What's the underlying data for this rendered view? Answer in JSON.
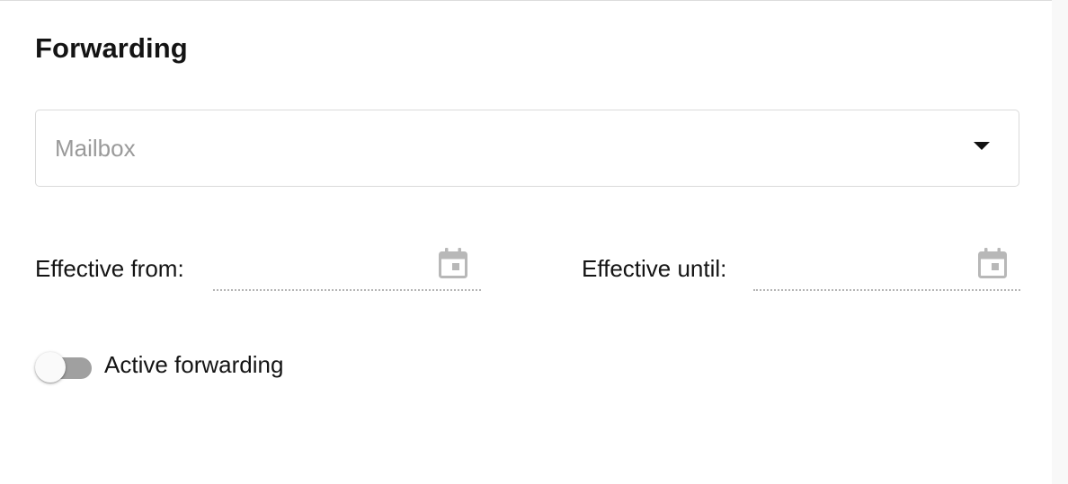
{
  "section": {
    "title": "Forwarding"
  },
  "mailbox_select": {
    "placeholder": "Mailbox",
    "selected_value": "",
    "arrow_icon": "caret-down-icon"
  },
  "effective_from": {
    "label": "Effective from:",
    "value": "",
    "icon": "calendar-icon"
  },
  "effective_until": {
    "label": "Effective until:",
    "value": "",
    "icon": "calendar-icon"
  },
  "active_forwarding": {
    "label": "Active forwarding",
    "enabled": false
  },
  "colors": {
    "text": "#141414",
    "placeholder": "#9a9a9a",
    "border": "#dadada",
    "icon_gray": "#b8b8b8",
    "toggle_track_off": "#a0a0a0",
    "toggle_thumb": "#fafafa"
  }
}
